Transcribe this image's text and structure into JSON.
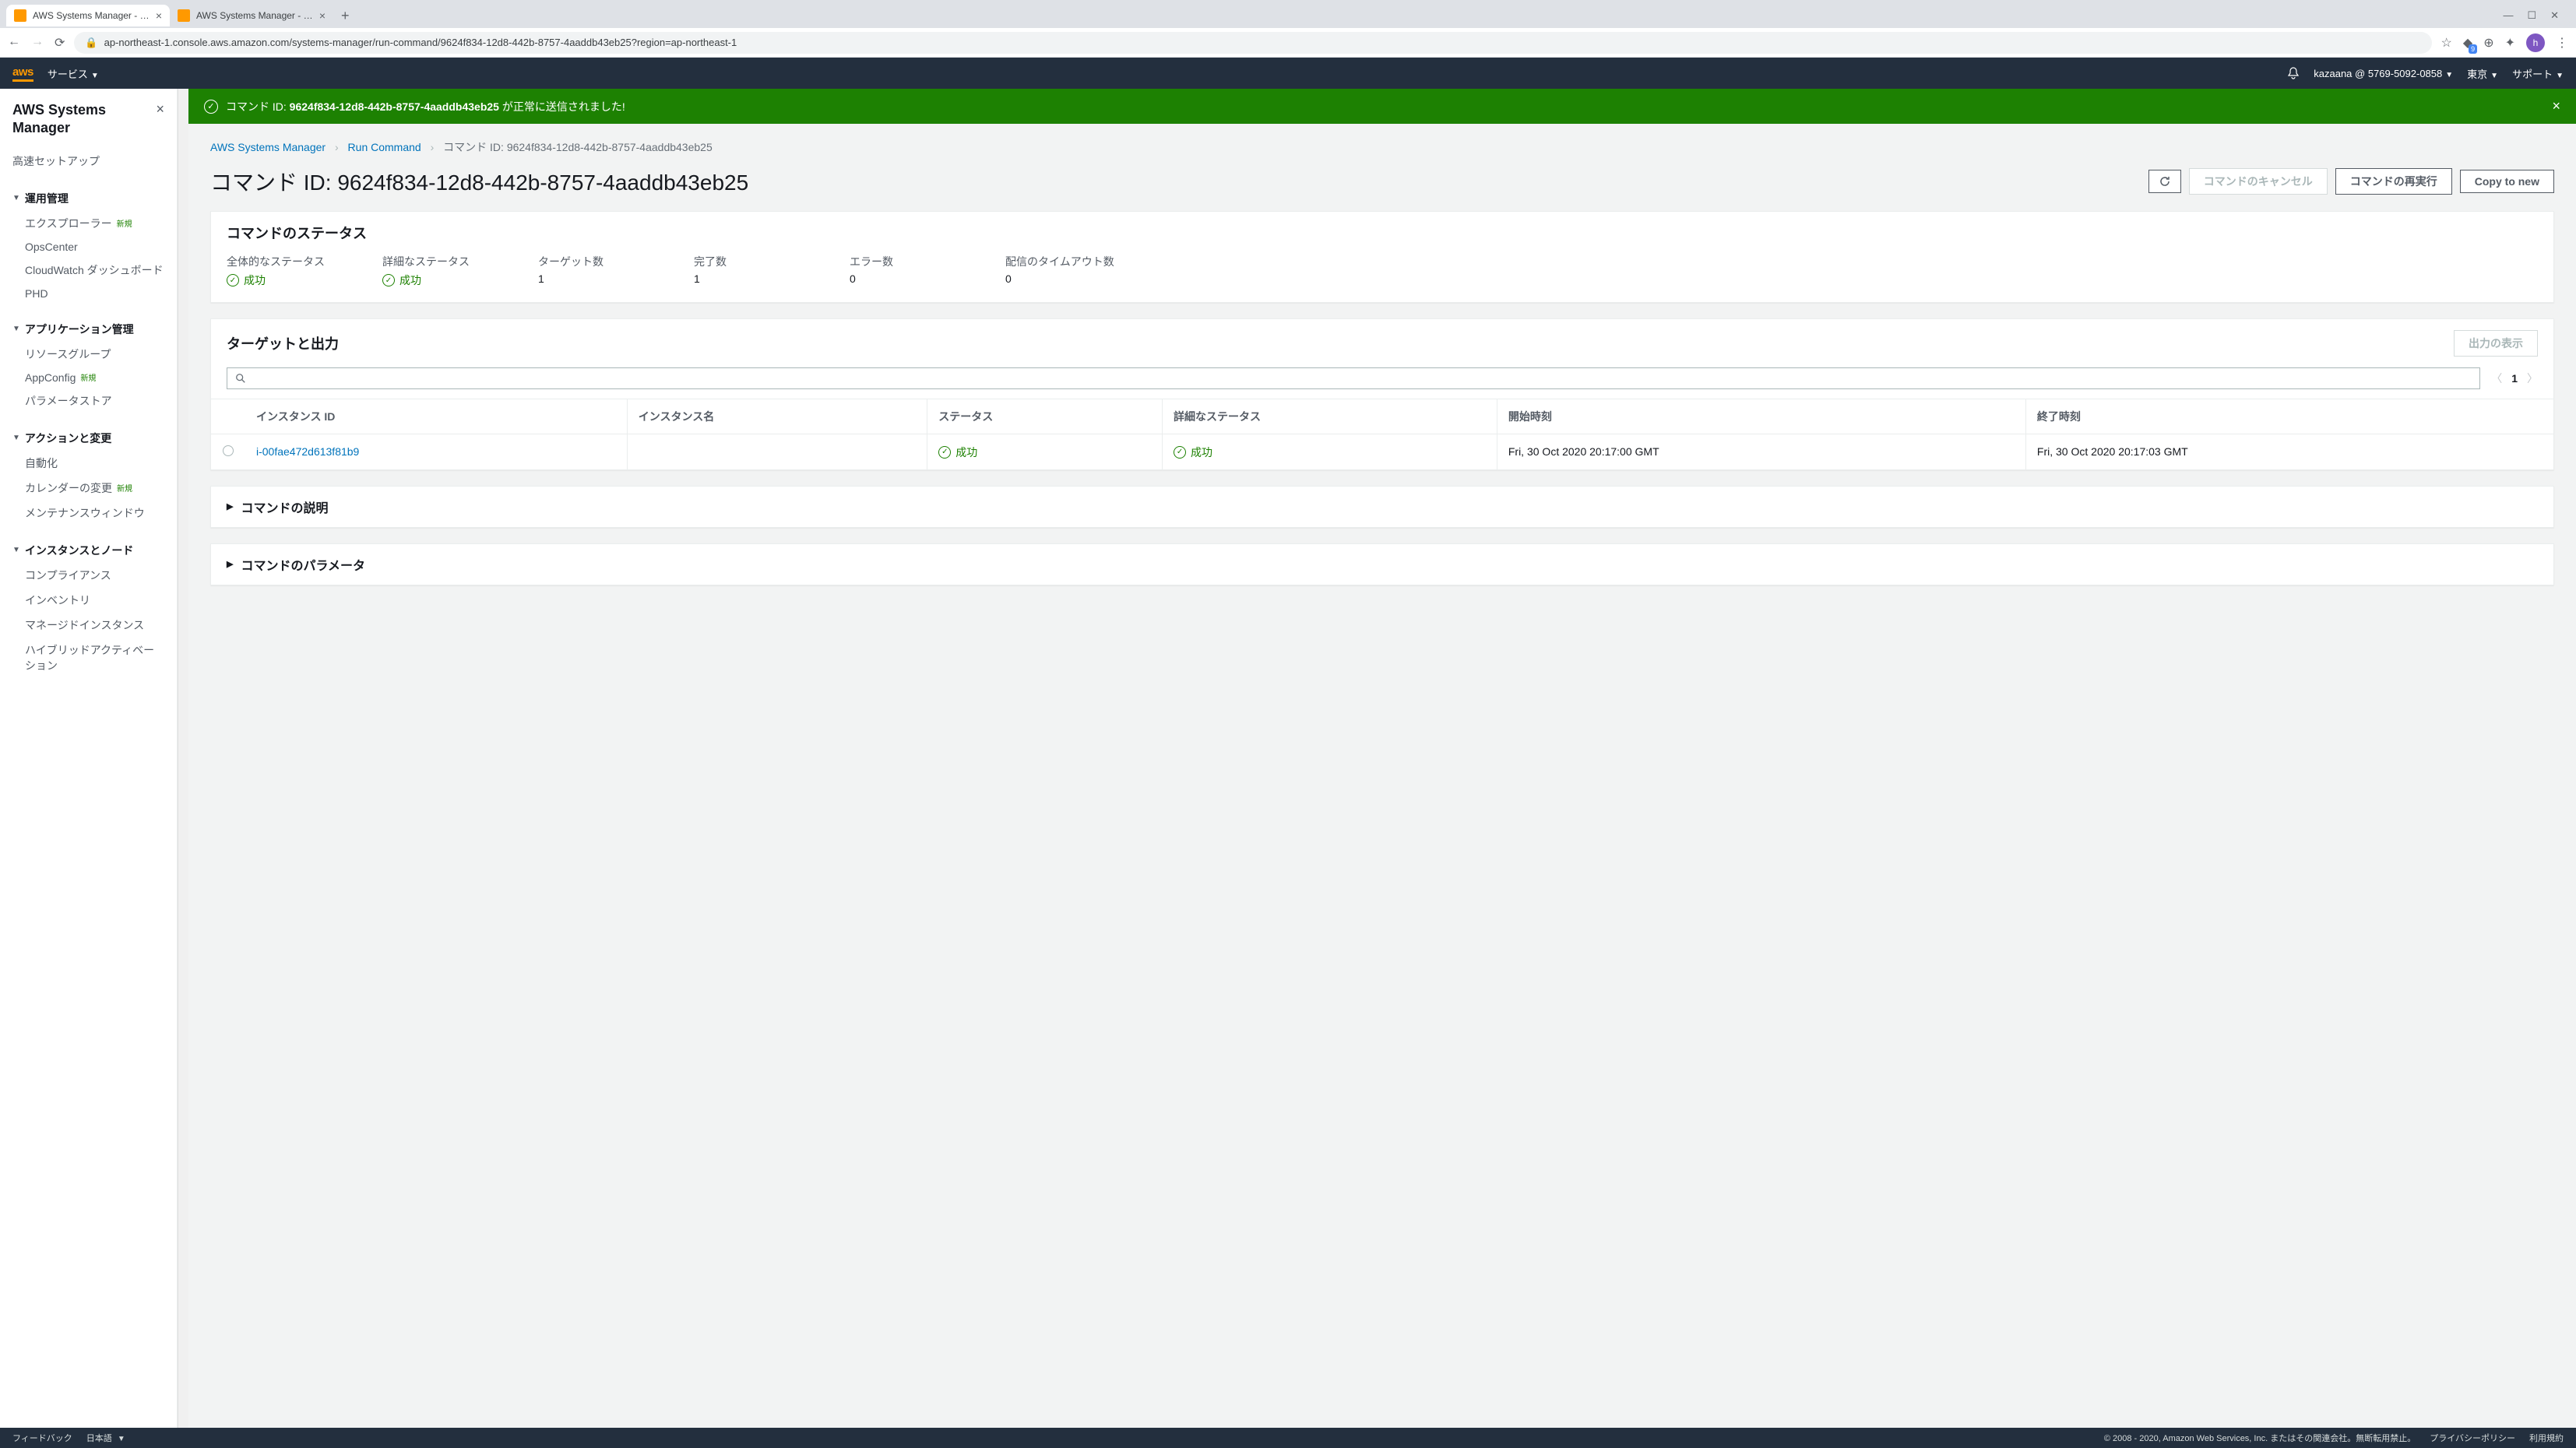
{
  "browser": {
    "tabs": [
      {
        "title": "AWS Systems Manager - Run Co",
        "active": true
      },
      {
        "title": "AWS Systems Manager - Sessio",
        "active": false
      }
    ],
    "url": "ap-northeast-1.console.aws.amazon.com/systems-manager/run-command/9624f834-12d8-442b-8757-4aaddb43eb25?region=ap-northeast-1",
    "avatar": "h",
    "ext_badge": "9"
  },
  "aws_nav": {
    "logo": "aws",
    "services": "サービス",
    "account": "kazaana @ 5769-5092-0858",
    "region": "東京",
    "support": "サポート"
  },
  "sidebar": {
    "title": "AWS Systems Manager",
    "quick_setup": "高速セットアップ",
    "sections": [
      {
        "title": "運用管理",
        "items": [
          {
            "label": "エクスプローラー",
            "badge": "新規"
          },
          {
            "label": "OpsCenter"
          },
          {
            "label": "CloudWatch ダッシュボード"
          },
          {
            "label": "PHD"
          }
        ]
      },
      {
        "title": "アプリケーション管理",
        "items": [
          {
            "label": "リソースグループ"
          },
          {
            "label": "AppConfig",
            "badge": "新規"
          },
          {
            "label": "パラメータストア"
          }
        ]
      },
      {
        "title": "アクションと変更",
        "items": [
          {
            "label": "自動化"
          },
          {
            "label": "カレンダーの変更",
            "badge": "新規"
          },
          {
            "label": "メンテナンスウィンドウ"
          }
        ]
      },
      {
        "title": "インスタンスとノード",
        "items": [
          {
            "label": "コンプライアンス"
          },
          {
            "label": "インベントリ"
          },
          {
            "label": "マネージドインスタンス"
          },
          {
            "label": "ハイブリッドアクティベーション"
          }
        ]
      }
    ]
  },
  "alert": {
    "prefix": "コマンド ID: ",
    "id": "9624f834-12d8-442b-8757-4aaddb43eb25",
    "suffix": " が正常に送信されました!"
  },
  "breadcrumb": {
    "items": [
      "AWS Systems Manager",
      "Run Command",
      "コマンド ID: 9624f834-12d8-442b-8757-4aaddb43eb25"
    ]
  },
  "page": {
    "title": "コマンド ID: 9624f834-12d8-442b-8757-4aaddb43eb25",
    "btn_cancel": "コマンドのキャンセル",
    "btn_rerun": "コマンドの再実行",
    "btn_copy": "Copy to new"
  },
  "status_panel": {
    "title": "コマンドのステータス",
    "stats": [
      {
        "label": "全体的なステータス",
        "value": "成功",
        "ok": true
      },
      {
        "label": "詳細なステータス",
        "value": "成功",
        "ok": true
      },
      {
        "label": "ターゲット数",
        "value": "1"
      },
      {
        "label": "完了数",
        "value": "1"
      },
      {
        "label": "エラー数",
        "value": "0"
      },
      {
        "label": "配信のタイムアウト数",
        "value": "0"
      }
    ]
  },
  "targets_panel": {
    "title": "ターゲットと出力",
    "btn_view_output": "出力の表示",
    "page": "1",
    "columns": [
      "インスタンス ID",
      "インスタンス名",
      "ステータス",
      "詳細なステータス",
      "開始時刻",
      "終了時刻"
    ],
    "rows": [
      {
        "instance_id": "i-00fae472d613f81b9",
        "instance_name": "",
        "status": "成功",
        "detailed_status": "成功",
        "start": "Fri, 30 Oct 2020 20:17:00 GMT",
        "end": "Fri, 30 Oct 2020 20:17:03 GMT"
      }
    ]
  },
  "expand_panels": {
    "description": "コマンドの説明",
    "parameters": "コマンドのパラメータ"
  },
  "footer": {
    "feedback": "フィードバック",
    "language": "日本語",
    "copyright": "© 2008 - 2020, Amazon Web Services, Inc. またはその関連会社。無断転用禁止。",
    "privacy": "プライバシーポリシー",
    "terms": "利用規約"
  }
}
